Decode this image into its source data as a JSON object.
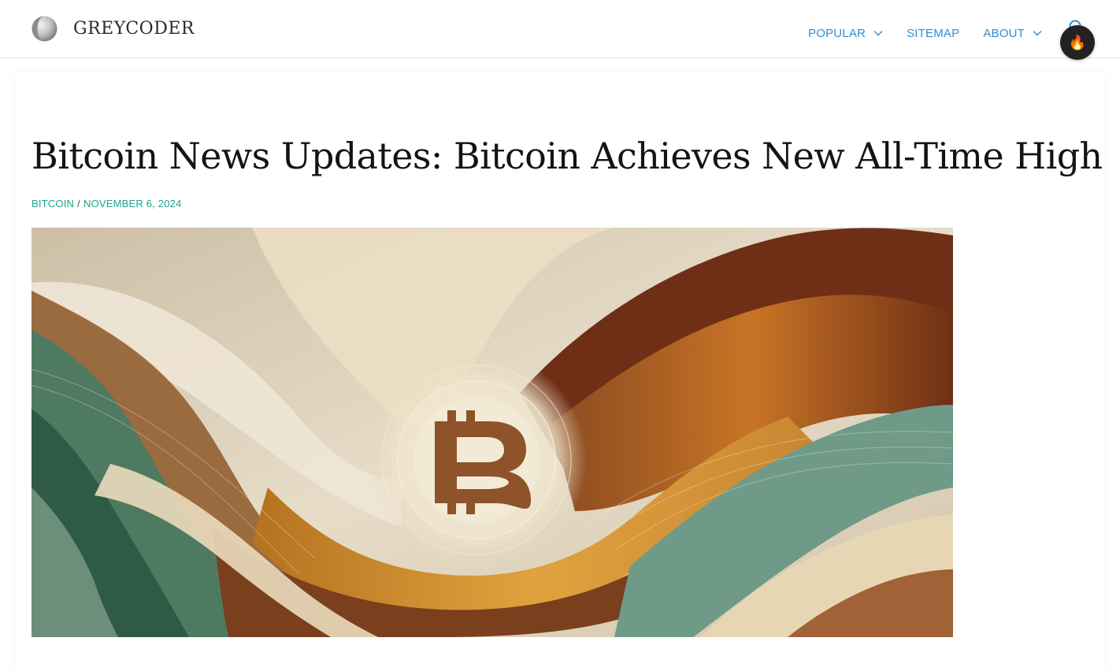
{
  "header": {
    "brand_name": "GREYCODER",
    "nav": [
      {
        "label": "POPULAR",
        "has_dropdown": true
      },
      {
        "label": "SITEMAP",
        "has_dropdown": false
      },
      {
        "label": "ABOUT",
        "has_dropdown": true
      }
    ],
    "search_icon": "search-icon",
    "fire_button_glyph": "🔥"
  },
  "article": {
    "title": "Bitcoin News Updates: Bitcoin Achieves New All-Time High",
    "category": "BITCOIN",
    "separator": "/",
    "date": "NOVEMBER 6, 2024",
    "hero_image": "abstract-bitcoin-waves-illustration"
  },
  "colors": {
    "nav_link": "#2f8fcf",
    "meta_link": "#1aa58a",
    "title": "#141414",
    "fire_button_bg": "#222222"
  }
}
